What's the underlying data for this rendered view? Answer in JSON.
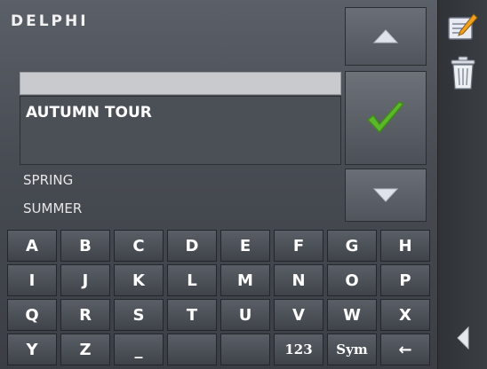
{
  "header": {
    "brand": "DELPHI"
  },
  "list": {
    "input_value": "",
    "selected": "AUTUMN TOUR",
    "items": [
      "SPRING",
      "SUMMER"
    ]
  },
  "keyboard": {
    "rows": [
      [
        "A",
        "B",
        "C",
        "D",
        "E",
        "F",
        "G",
        "H"
      ],
      [
        "I",
        "J",
        "K",
        "L",
        "M",
        "N",
        "O",
        "P"
      ],
      [
        "Q",
        "R",
        "S",
        "T",
        "U",
        "V",
        "W",
        "X"
      ],
      [
        "Y",
        "Z",
        "_",
        "",
        "",
        "123",
        "Sym",
        "←"
      ]
    ]
  },
  "icons": {
    "up": "arrow-up-icon",
    "down": "arrow-down-icon",
    "ok": "checkmark-icon",
    "edit": "edit-icon",
    "trash": "trash-icon",
    "back": "back-triangle-icon"
  },
  "colors": {
    "check": "#5cb82a",
    "arrow": "#dfe3ea"
  }
}
